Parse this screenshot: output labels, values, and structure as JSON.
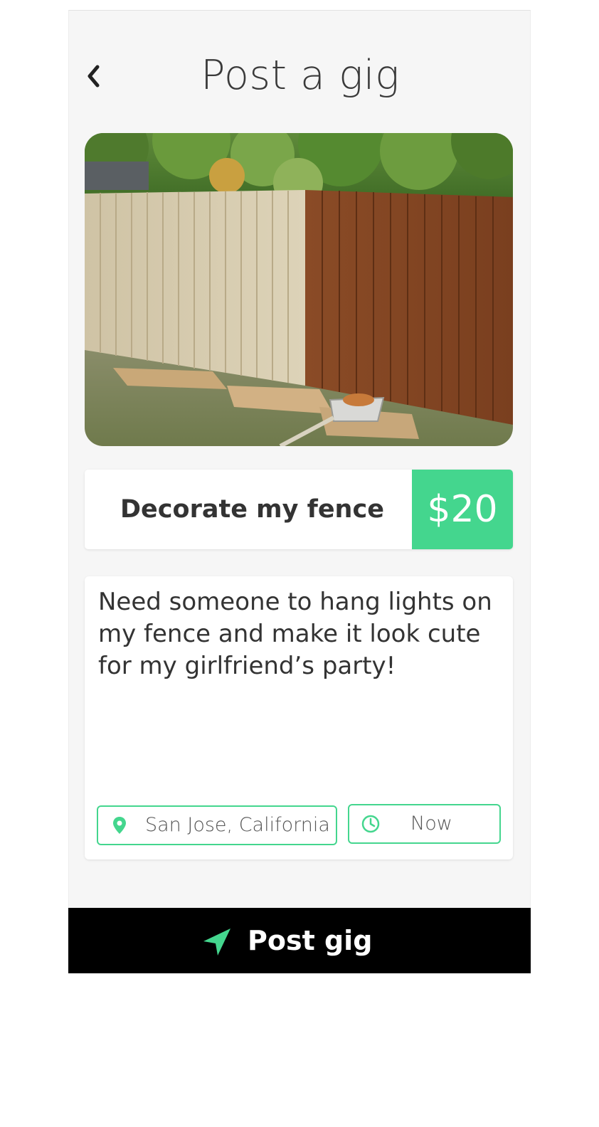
{
  "header": {
    "title": "Post a gig",
    "back_icon": "chevron-left-icon"
  },
  "photo": {
    "subject": "half-stained wooden fence",
    "icon": "fence-photo"
  },
  "gig": {
    "title": "Decorate my fence",
    "price": "$20",
    "description": "Need someone to hang lights on my fence and make it look cute for my girlfriend’s party!"
  },
  "location": {
    "icon": "map-pin-icon",
    "value": "San Jose, California"
  },
  "time": {
    "icon": "clock-icon",
    "value": "Now"
  },
  "footer": {
    "icon": "navigation-arrow-icon",
    "label": "Post gig"
  },
  "colors": {
    "accent": "#44d68e",
    "screen_background": "#f6f6f6",
    "footer_background": "#000000",
    "text": "#333333"
  }
}
